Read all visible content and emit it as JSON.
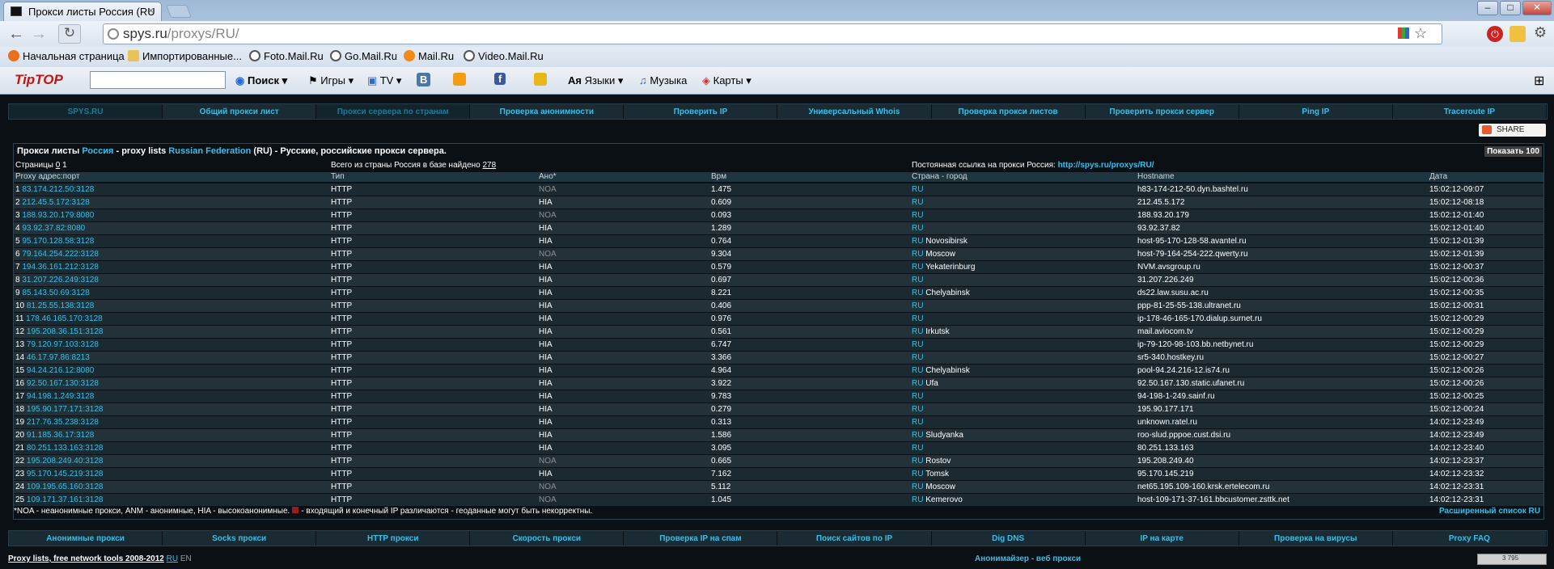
{
  "browser": {
    "tab_title": "Прокси листы Россия (RU",
    "tab_close": "×",
    "url_host": "spys.ru",
    "url_path": "/proxys/RU/",
    "bookmarks": [
      "Начальная страница",
      "Импортированные...",
      "Foto.Mail.Ru",
      "Go.Mail.Ru",
      "Mail.Ru",
      "Video.Mail.Ru"
    ],
    "toolbar2": {
      "logo": "TipTOP",
      "search_button": "Поиск",
      "items": [
        "Игры",
        "TV",
        "В",
        "",
        "f",
        "",
        "Языки",
        "Музыка",
        "Карты"
      ]
    }
  },
  "top_nav": [
    {
      "label": "SPYS.RU",
      "dim": true
    },
    {
      "label": "Общий прокси лист",
      "dim": false
    },
    {
      "label": "Прокси сервера по странам",
      "dim": true
    },
    {
      "label": "Проверка анонимности",
      "dim": false
    },
    {
      "label": "Проверить IP",
      "dim": false
    },
    {
      "label": "Универсальный Whois",
      "dim": false
    },
    {
      "label": "Проверка прокси листов",
      "dim": false
    },
    {
      "label": "Проверить прокси сервер",
      "dim": false
    },
    {
      "label": "Ping IP",
      "dim": false
    },
    {
      "label": "Traceroute IP",
      "dim": false
    }
  ],
  "share_label": "SHARE",
  "title": {
    "prefix": "Прокси листы ",
    "country_link": "Россия",
    "mid": " - proxy lists ",
    "country_en": "Russian Federation",
    "suffix": " (RU) - Русские, российские прокси сервера."
  },
  "show100": "Показать 100",
  "pages_label": "Страницы",
  "pages": [
    "0",
    "1"
  ],
  "total_label": "Всего из страны Россия в базе найдено",
  "total_count": "278",
  "permalink_label": "Постоянная ссылка на прокси Россия:",
  "permalink_url": "http://spys.ru/proxys/RU/",
  "columns": [
    "Proxy адрес:порт",
    "Тип",
    "Ано*",
    "Врм",
    "Страна - город",
    "Hostname",
    "Дата"
  ],
  "rows": [
    [
      "1",
      "83.174.212.50:3128",
      "HTTP",
      "NOA",
      "1.475",
      "RU",
      "",
      "h83-174-212-50.dyn.bashtel.ru",
      "15:02:12-09:07"
    ],
    [
      "2",
      "212.45.5.172:3128",
      "HTTP",
      "HIA",
      "0.609",
      "RU",
      "",
      "212.45.5.172",
      "15:02:12-08:18"
    ],
    [
      "3",
      "188.93.20.179:8080",
      "HTTP",
      "NOA",
      "0.093",
      "RU",
      "",
      "188.93.20.179",
      "15:02:12-01:40"
    ],
    [
      "4",
      "93.92.37.82:8080",
      "HTTP",
      "HIA",
      "1.289",
      "RU",
      "",
      "93.92.37.82",
      "15:02:12-01:40"
    ],
    [
      "5",
      "95.170.128.58:3128",
      "HTTP",
      "HIA",
      "0.764",
      "RU",
      "Novosibirsk",
      "host-95-170-128-58.avantel.ru",
      "15:02:12-01:39"
    ],
    [
      "6",
      "79.164.254.222:3128",
      "HTTP",
      "NOA",
      "9.304",
      "RU",
      "Moscow",
      "host-79-164-254-222.qwerty.ru",
      "15:02:12-01:39"
    ],
    [
      "7",
      "194.36.161.212:3128",
      "HTTP",
      "HIA",
      "0.579",
      "RU",
      "Yekaterinburg",
      "NVM.avsgroup.ru",
      "15:02:12-00:37"
    ],
    [
      "8",
      "31.207.226.249:3128",
      "HTTP",
      "HIA",
      "0.697",
      "RU",
      "",
      "31.207.226.249",
      "15:02:12-00:36"
    ],
    [
      "9",
      "85.143.50.69:3128",
      "HTTP",
      "HIA",
      "8.221",
      "RU",
      "Chelyabinsk",
      "ds22.law.susu.ac.ru",
      "15:02:12-00:35"
    ],
    [
      "10",
      "81.25.55.138:3128",
      "HTTP",
      "HIA",
      "0.406",
      "RU",
      "",
      "ppp-81-25-55-138.ultranet.ru",
      "15:02:12-00:31"
    ],
    [
      "11",
      "178.46.165.170:3128",
      "HTTP",
      "HIA",
      "0.976",
      "RU",
      "",
      "ip-178-46-165-170.dialup.surnet.ru",
      "15:02:12-00:29"
    ],
    [
      "12",
      "195.208.36.151:3128",
      "HTTP",
      "HIA",
      "0.561",
      "RU",
      "Irkutsk",
      "mail.aviocom.tv",
      "15:02:12-00:29"
    ],
    [
      "13",
      "79.120.97.103:3128",
      "HTTP",
      "HIA",
      "6.747",
      "RU",
      "",
      "ip-79-120-98-103.bb.netbynet.ru",
      "15:02:12-00:29"
    ],
    [
      "14",
      "46.17.97.86:8213",
      "HTTP",
      "HIA",
      "3.366",
      "RU",
      "",
      "sr5-340.hostkey.ru",
      "15:02:12-00:27"
    ],
    [
      "15",
      "94.24.216.12:8080",
      "HTTP",
      "HIA",
      "4.964",
      "RU",
      "Chelyabinsk",
      "pool-94.24.216-12.is74.ru",
      "15:02:12-00:26"
    ],
    [
      "16",
      "92.50.167.130:3128",
      "HTTP",
      "HIA",
      "3.922",
      "RU",
      "Ufa",
      "92.50.167.130.static.ufanet.ru",
      "15:02:12-00:26"
    ],
    [
      "17",
      "94.198.1.249:3128",
      "HTTP",
      "HIA",
      "9.783",
      "RU",
      "",
      "94-198-1-249.sainf.ru",
      "15:02:12-00:25"
    ],
    [
      "18",
      "195.90.177.171:3128",
      "HTTP",
      "HIA",
      "0.279",
      "RU",
      "",
      "195.90.177.171",
      "15:02:12-00:24"
    ],
    [
      "19",
      "217.76.35.238:3128",
      "HTTP",
      "HIA",
      "0.313",
      "RU",
      "",
      "unknown.ratel.ru",
      "14:02:12-23:49"
    ],
    [
      "20",
      "91.185.36.17:3128",
      "HTTP",
      "HIA",
      "1.586",
      "RU",
      "Sludyanka",
      "roo-slud.pppoe.cust.dsi.ru",
      "14:02:12-23:49"
    ],
    [
      "21",
      "80.251.133.163:3128",
      "HTTP",
      "HIA",
      "3.095",
      "RU",
      "",
      "80.251.133.163",
      "14:02:12-23:40"
    ],
    [
      "22",
      "195.208.249.40:3128",
      "HTTP",
      "NOA",
      "0.665",
      "RU",
      "Rostov",
      "195.208.249.40",
      "14:02:12-23:37"
    ],
    [
      "23",
      "95.170.145.219:3128",
      "HTTP",
      "HIA",
      "7.162",
      "RU",
      "Tomsk",
      "95.170.145.219",
      "14:02:12-23:32"
    ],
    [
      "24",
      "109.195.65.160:3128",
      "HTTP",
      "NOA",
      "5.112",
      "RU",
      "Moscow",
      "net65.195.109-160.krsk.ertelecom.ru",
      "14:02:12-23:31"
    ],
    [
      "25",
      "109.171.37.161:3128",
      "HTTP",
      "NOA",
      "1.045",
      "RU",
      "Kemerovo",
      "host-109-171-37-161.bbcustomer.zsttk.net",
      "14:02:12-23:31"
    ]
  ],
  "footnote_a": "*NOA - неанонимные прокси, ANM - анонимные, HIA - высокоанонимные.",
  "footnote_b": "- входящий и конечный IP различаются - геоданные могут быть некорректны.",
  "extended_list": "Расширенный список RU",
  "bottom_nav": [
    "Анонимные прокси",
    "Socks прокси",
    "HTTP прокси",
    "Скорость прокси",
    "Проверка IP на спам",
    "Поиск сайтов по IP",
    "Dig DNS",
    "IP на карте",
    "Проверка на вирусы",
    "Proxy FAQ"
  ],
  "copyright": "Proxy lists, free network tools 2008-2012",
  "lang_ru": "RU",
  "lang_en": "EN",
  "anonymizer": "Анонимайзер - веб прокси",
  "counter_text": "3 795"
}
